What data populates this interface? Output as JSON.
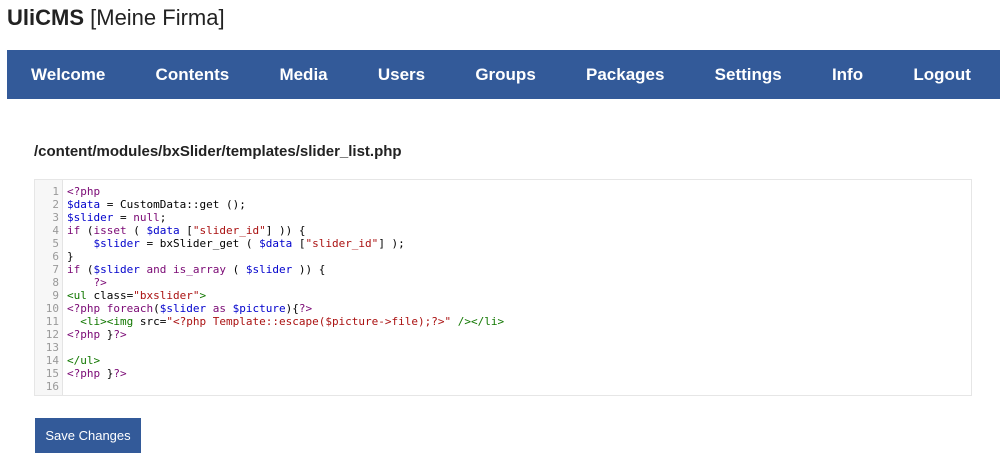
{
  "app": {
    "brand": "UliCMS",
    "site": "[Meine Firma]"
  },
  "nav": [
    {
      "label": "Welcome"
    },
    {
      "label": "Contents"
    },
    {
      "label": "Media"
    },
    {
      "label": "Users"
    },
    {
      "label": "Groups"
    },
    {
      "label": "Packages"
    },
    {
      "label": "Settings"
    },
    {
      "label": "Info"
    },
    {
      "label": "Logout"
    }
  ],
  "file_path": "/content/modules/bxSlider/templates/slider_list.php",
  "editor": {
    "line_numbers": [
      "1",
      "2",
      "3",
      "4",
      "5",
      "6",
      "7",
      "8",
      "9",
      "10",
      "11",
      "12",
      "13",
      "14",
      "15",
      "16"
    ],
    "lines": [
      "<?php",
      "$data = CustomData::get ();",
      "$slider = null;",
      "if (isset ( $data [\"slider_id\"] )) {",
      "    $slider = bxSlider_get ( $data [\"slider_id\"] );",
      "}",
      "if ($slider and is_array ( $slider )) {",
      "    ?>",
      "<ul class=\"bxslider\">",
      "<?php foreach($slider as $picture){?>",
      "  <li><img src=\"<?php Template::escape($picture->file);?>\" /></li>",
      "<?php }?>",
      "",
      "</ul>",
      "<?php }?>",
      ""
    ]
  },
  "save_button": "Save Changes",
  "colors": {
    "nav_bg": "#335a99",
    "button_bg": "#335a99",
    "text_light": "#ffffff"
  }
}
